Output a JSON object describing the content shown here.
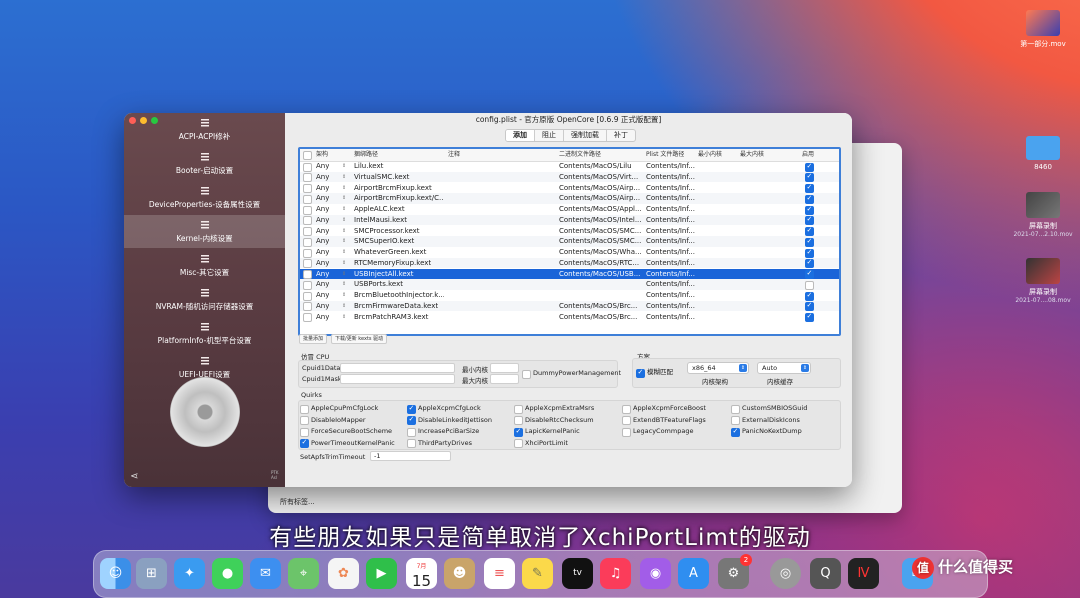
{
  "desktop": {
    "icons": [
      {
        "label": "第一部分.mov",
        "sub": ""
      },
      {
        "label": "8460",
        "sub": ""
      },
      {
        "label": "屏幕录制",
        "sub": "2021-07...2.10.mov"
      },
      {
        "label": "屏幕录制",
        "sub": "2021-07....08.mov"
      }
    ]
  },
  "back_window": {
    "footer": "所有标签..."
  },
  "window": {
    "title": "config.plist - 官方原版 OpenCore [0.6.9 正式版配置]",
    "sidebar": {
      "items": [
        {
          "label": "ACPI-ACPI修补"
        },
        {
          "label": "Booter-启动设置"
        },
        {
          "label": "DeviceProperties-设备属性设置"
        },
        {
          "label": "Kernel-内核设置"
        },
        {
          "label": "Misc-其它设置"
        },
        {
          "label": "NVRAM-随机访问存储器设置"
        },
        {
          "label": "PlatformInfo-机型平台设置"
        },
        {
          "label": "UEFI-UEFI设置"
        }
      ],
      "version": "PTK\nAsl"
    },
    "tabs": [
      "添加",
      "阻止",
      "强制加载",
      "补丁"
    ],
    "table": {
      "headers": {
        "arch": "架构",
        "bundle": "捆绑路径",
        "comment": "注释",
        "exec": "二进制文件路径",
        "plist": "Plist 文件路径",
        "min": "最小内核",
        "max": "最大内核",
        "enabled": "启用"
      },
      "rows": [
        {
          "arch": "Any",
          "bundle": "Lilu.kext",
          "exec": "Contents/MacOS/Lilu",
          "plist": "Contents/Inf...",
          "enabled": true
        },
        {
          "arch": "Any",
          "bundle": "VirtualSMC.kext",
          "exec": "Contents/MacOS/Virt...",
          "plist": "Contents/Inf...",
          "enabled": true
        },
        {
          "arch": "Any",
          "bundle": "AirportBrcmFixup.kext",
          "exec": "Contents/MacOS/Airp...",
          "plist": "Contents/Inf...",
          "enabled": true
        },
        {
          "arch": "Any",
          "bundle": "AirportBrcmFixup.kext/C...",
          "exec": "Contents/MacOS/Airp...",
          "plist": "Contents/Inf...",
          "enabled": true
        },
        {
          "arch": "Any",
          "bundle": "AppleALC.kext",
          "exec": "Contents/MacOS/Appl...",
          "plist": "Contents/Inf...",
          "enabled": true
        },
        {
          "arch": "Any",
          "bundle": "IntelMausi.kext",
          "exec": "Contents/MacOS/Intel...",
          "plist": "Contents/Inf...",
          "enabled": true
        },
        {
          "arch": "Any",
          "bundle": "SMCProcessor.kext",
          "exec": "Contents/MacOS/SMC...",
          "plist": "Contents/Inf...",
          "enabled": true
        },
        {
          "arch": "Any",
          "bundle": "SMCSuperIO.kext",
          "exec": "Contents/MacOS/SMC...",
          "plist": "Contents/Inf...",
          "enabled": true
        },
        {
          "arch": "Any",
          "bundle": "WhateverGreen.kext",
          "exec": "Contents/MacOS/Wha...",
          "plist": "Contents/Inf...",
          "enabled": true
        },
        {
          "arch": "Any",
          "bundle": "RTCMemoryFixup.kext",
          "exec": "Contents/MacOS/RTC...",
          "plist": "Contents/Inf...",
          "enabled": true
        },
        {
          "arch": "Any",
          "bundle": "USBInjectAll.kext",
          "exec": "Contents/MacOS/USB...",
          "plist": "Contents/Inf...",
          "enabled": true,
          "selected": true
        },
        {
          "arch": "Any",
          "bundle": "USBPorts.kext",
          "exec": "",
          "plist": "Contents/Inf...",
          "enabled": false
        },
        {
          "arch": "Any",
          "bundle": "BrcmBluetoothInjector.k...",
          "exec": "",
          "plist": "Contents/Inf...",
          "enabled": true
        },
        {
          "arch": "Any",
          "bundle": "BrcmFirmwareData.kext",
          "exec": "Contents/MacOS/Brc...",
          "plist": "Contents/Inf...",
          "enabled": true
        },
        {
          "arch": "Any",
          "bundle": "BrcmPatchRAM3.kext",
          "exec": "Contents/MacOS/Brc...",
          "plist": "Contents/Inf...",
          "enabled": true
        }
      ],
      "buttons": [
        "批量添加",
        "下载/更新 kexts 驱动"
      ]
    },
    "cpu": {
      "title": "仿冒 CPU",
      "cpuid1data_label": "Cpuid1Data",
      "cpuid1mask_label": "Cpuid1Mask",
      "min_kernel_label": "最小内核",
      "max_kernel_label": "最大内核",
      "dummy_label": "DummyPowerManagement"
    },
    "scheme": {
      "title": "方案",
      "fuzzy_label": "模糊匹配",
      "arch_value": "x86_64",
      "arch_label": "内核架构",
      "cache_value": "Auto",
      "cache_label": "内核缓存"
    },
    "quirks": {
      "title": "Quirks",
      "items": [
        {
          "label": "AppleCpuPmCfgLock",
          "checked": false
        },
        {
          "label": "AppleXcpmCfgLock",
          "checked": true
        },
        {
          "label": "AppleXcpmExtraMsrs",
          "checked": false
        },
        {
          "label": "AppleXcpmForceBoost",
          "checked": false
        },
        {
          "label": "CustomSMBIOSGuid",
          "checked": false
        },
        {
          "label": "DisableIoMapper",
          "checked": false
        },
        {
          "label": "DisableLinkeditJettison",
          "checked": true
        },
        {
          "label": "DisableRtcChecksum",
          "checked": false
        },
        {
          "label": "ExtendBTFeatureFlags",
          "checked": false
        },
        {
          "label": "ExternalDiskIcons",
          "checked": false
        },
        {
          "label": "ForceSecureBootScheme",
          "checked": false
        },
        {
          "label": "IncreasePciBarSize",
          "checked": false
        },
        {
          "label": "LapicKernelPanic",
          "checked": true
        },
        {
          "label": "LegacyCommpage",
          "checked": false
        },
        {
          "label": "PanicNoKextDump",
          "checked": true
        },
        {
          "label": "PowerTimeoutKernelPanic",
          "checked": true
        },
        {
          "label": "ThirdPartyDrives",
          "checked": false
        },
        {
          "label": "XhciPortLimit",
          "checked": false
        }
      ],
      "trim_label": "SetApfsTrimTimeout",
      "trim_value": "-1"
    }
  },
  "subtitle": "有些朋友如果只是简单取消了XchiPortLimt的驱动",
  "dock": {
    "calendar_month": "7月",
    "calendar_day": "15",
    "badge": "2"
  },
  "watermark": "什么值得买",
  "watermark_badge": "值"
}
